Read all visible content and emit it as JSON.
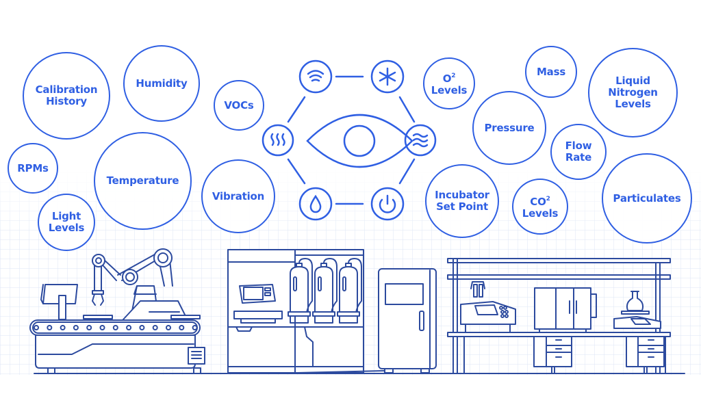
{
  "colors": {
    "bubble": "#2f5fe3",
    "equipment": "#2c4a9e",
    "grid": "#dce6f6",
    "background": "#ffffff"
  },
  "hub": {
    "center_icon": "eye-icon",
    "nodes": [
      {
        "name": "wifi-signal-icon"
      },
      {
        "name": "snowflake-asterisk-icon"
      },
      {
        "name": "water-waves-icon"
      },
      {
        "name": "power-icon"
      },
      {
        "name": "water-drop-icon"
      },
      {
        "name": "heat-waves-icon"
      }
    ]
  },
  "bubbles": [
    {
      "id": "calibration-history",
      "label": "Calibration\nHistory"
    },
    {
      "id": "humidity",
      "label": "Humidity"
    },
    {
      "id": "vocs",
      "label": "VOCs"
    },
    {
      "id": "rpms",
      "label": "RPMs"
    },
    {
      "id": "temperature",
      "label": "Temperature"
    },
    {
      "id": "light-levels",
      "label": "Light\nLevels"
    },
    {
      "id": "vibration",
      "label": "Vibration"
    },
    {
      "id": "o2-levels",
      "label": "O",
      "sup": "2",
      "label2": "Levels"
    },
    {
      "id": "mass",
      "label": "Mass"
    },
    {
      "id": "liquid-nitrogen-levels",
      "label": "Liquid\nNitrogen\nLevels"
    },
    {
      "id": "pressure",
      "label": "Pressure"
    },
    {
      "id": "flow-rate",
      "label": "Flow\nRate"
    },
    {
      "id": "incubator-set-point",
      "label": "Incubator\nSet Point"
    },
    {
      "id": "co2-levels",
      "label": "CO",
      "sup": "2",
      "label2": "Levels"
    },
    {
      "id": "particulates",
      "label": "Particulates"
    }
  ],
  "equipment": [
    {
      "name": "robotic-arm-conveyor"
    },
    {
      "name": "gas-cylinder-cabinet"
    },
    {
      "name": "refrigerator"
    },
    {
      "name": "lab-bench"
    }
  ]
}
